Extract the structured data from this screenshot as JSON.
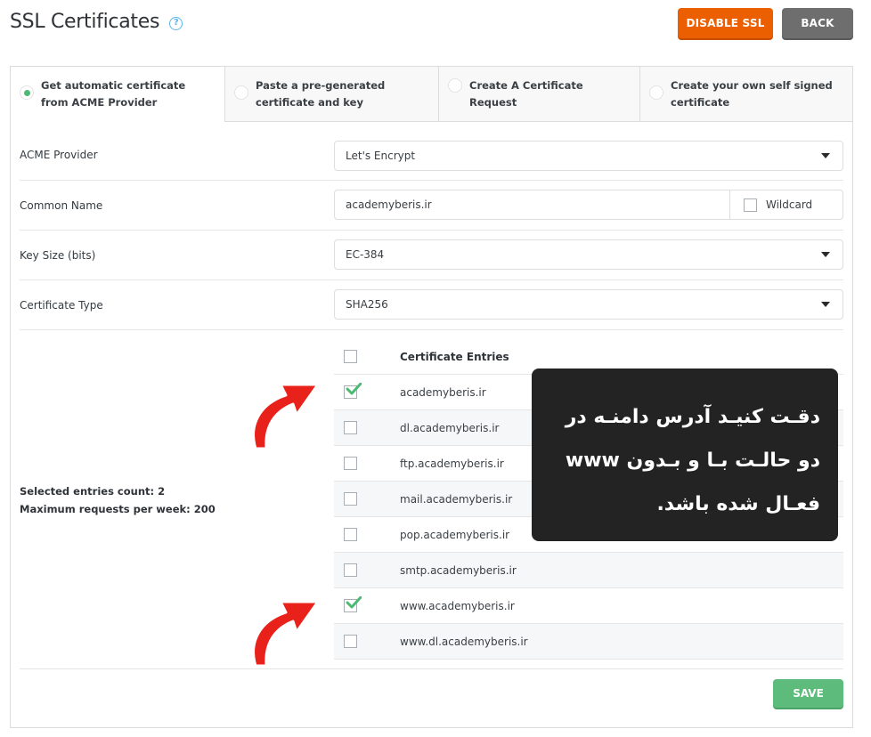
{
  "header": {
    "title": "SSL Certificates",
    "help_icon": "question-circle-icon",
    "disable_ssl_label": "DISABLE SSL",
    "back_label": "BACK"
  },
  "tabs": [
    {
      "label": "Get automatic certificate from ACME Provider",
      "selected": true
    },
    {
      "label": "Paste a pre-generated certificate and key",
      "selected": false
    },
    {
      "label": "Create A Certificate Request",
      "selected": false
    },
    {
      "label": "Create your own self signed certificate",
      "selected": false
    }
  ],
  "form": {
    "acme_provider": {
      "label": "ACME Provider",
      "value": "Let's Encrypt"
    },
    "common_name": {
      "label": "Common Name",
      "value": "academyberis.ir",
      "wildcard_label": "Wildcard",
      "wildcard_checked": false
    },
    "key_size": {
      "label": "Key Size (bits)",
      "value": "EC-384"
    },
    "certificate_type": {
      "label": "Certificate Type",
      "value": "SHA256"
    }
  },
  "entries": {
    "header": "Certificate Entries",
    "items": [
      {
        "domain": "academyberis.ir",
        "checked": true
      },
      {
        "domain": "dl.academyberis.ir",
        "checked": false
      },
      {
        "domain": "ftp.academyberis.ir",
        "checked": false
      },
      {
        "domain": "mail.academyberis.ir",
        "checked": false
      },
      {
        "domain": "pop.academyberis.ir",
        "checked": false
      },
      {
        "domain": "smtp.academyberis.ir",
        "checked": false
      },
      {
        "domain": "www.academyberis.ir",
        "checked": true
      },
      {
        "domain": "www.dl.academyberis.ir",
        "checked": false
      }
    ]
  },
  "summary": {
    "selected_count": "Selected entries count: 2",
    "max_requests": "Maximum requests per week: 200"
  },
  "save_label": "SAVE",
  "annotation": {
    "text": "دقـت کنیـد آدرس دامنـه در دو حالـت بـا و بـدون www فعـال شده باشد."
  },
  "colors": {
    "disable_ssl": "#ec5f00",
    "back": "#6e6e6e",
    "save": "#5dbc7b",
    "radio_selected": "#4cba73",
    "help": "#5ab4e8",
    "arrow": "#e8221b",
    "tooltip_bg": "#232323"
  }
}
